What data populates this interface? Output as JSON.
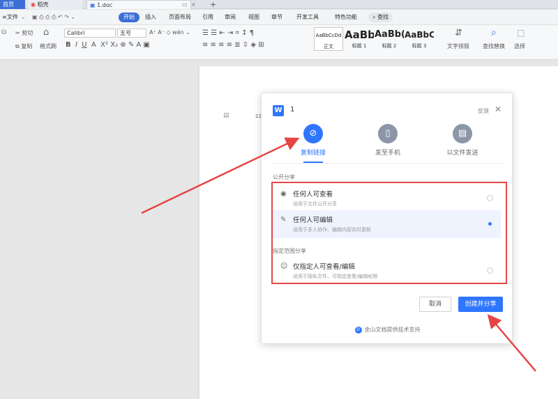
{
  "tabs": [
    {
      "label": "首页"
    },
    {
      "label": "稻壳"
    },
    {
      "label": "1.doc"
    }
  ],
  "menu": {
    "file": "文件",
    "items": [
      "开始",
      "插入",
      "页面布局",
      "引用",
      "审阅",
      "视图",
      "章节",
      "开发工具",
      "特色功能"
    ],
    "search": "查找"
  },
  "ribbon": {
    "cut": "剪切",
    "copy": "复制",
    "format_painter": "格式刷",
    "font": "Calibri",
    "font_size": "五号",
    "styles": [
      {
        "preview": "AaBbCcDd",
        "label": "正文"
      },
      {
        "preview": "AaBb",
        "label": "标题 1"
      },
      {
        "preview": "AaBb(",
        "label": "标题 2"
      },
      {
        "preview": "AaBbC",
        "label": "标题 3"
      }
    ],
    "text_layout": "文字排版",
    "find_replace": "查找替换",
    "select": "选择"
  },
  "doc": {
    "page_num": "22"
  },
  "dialog": {
    "title": "1",
    "feedback": "反馈",
    "share_options": [
      {
        "label": "复制链接",
        "icon": "link-icon",
        "selected": true
      },
      {
        "label": "发至手机",
        "icon": "phone-icon",
        "selected": false
      },
      {
        "label": "以文件发送",
        "icon": "file-icon",
        "selected": false
      }
    ],
    "public_section": "公开分享",
    "public_options": [
      {
        "title": "任何人可查看",
        "subtitle": "适用于文件公开分享",
        "icon": "eye-icon",
        "selected": false
      },
      {
        "title": "任何人可编辑",
        "subtitle": "适用于多人协作、编辑内容实时更新",
        "icon": "pencil-icon",
        "selected": true
      }
    ],
    "private_section": "指定范围分享",
    "private_options": [
      {
        "title": "仅指定人可查看/编辑",
        "subtitle": "适用于隐私文件、可指定查看/编辑权限",
        "icon": "user-icon",
        "selected": false
      }
    ],
    "cancel": "取消",
    "create": "创建并分享",
    "footer": "金山文档提供技术支持"
  },
  "colors": {
    "accent": "#2f76ff",
    "annotation": "#e54545",
    "home_tab": "#3c6fd6"
  }
}
